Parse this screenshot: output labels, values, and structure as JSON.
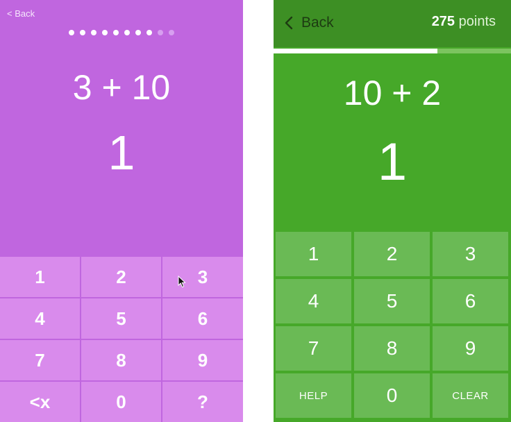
{
  "left": {
    "back_label": "< Back",
    "progress": {
      "total": 10,
      "completed": 8
    },
    "question": "3 + 10",
    "answer": "1",
    "keys": [
      "1",
      "2",
      "3",
      "4",
      "5",
      "6",
      "7",
      "8",
      "9",
      "<x",
      "0",
      "?"
    ],
    "colors": {
      "background": "#c066df",
      "key": "#d98bec"
    }
  },
  "right": {
    "back_label": "Back",
    "points_value": "275",
    "points_unit": "points",
    "progress_fraction": 0.69,
    "question": "10 + 2",
    "answer": "1",
    "keys": [
      "1",
      "2",
      "3",
      "4",
      "5",
      "6",
      "7",
      "8",
      "9",
      "HELP",
      "0",
      "CLEAR"
    ],
    "colors": {
      "background": "#46a829",
      "header": "#3d8f24",
      "key": "#6aba55"
    }
  }
}
